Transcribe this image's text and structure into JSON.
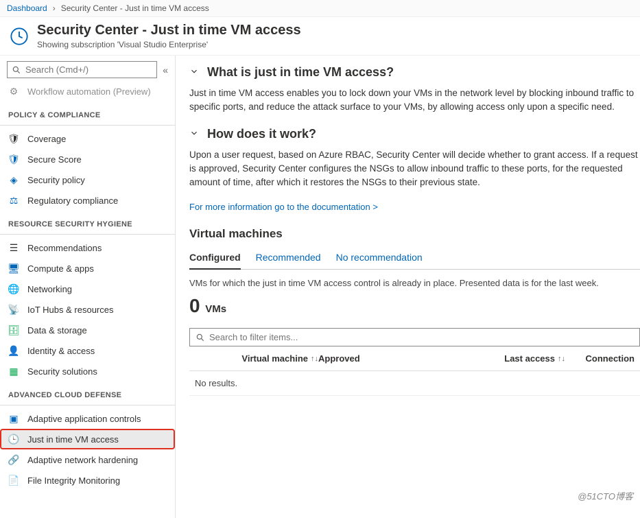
{
  "breadcrumb": {
    "root": "Dashboard",
    "current": "Security Center - Just in time VM access"
  },
  "header": {
    "title": "Security Center - Just in time VM access",
    "subtitle": "Showing subscription 'Visual Studio Enterprise'"
  },
  "search": {
    "placeholder": "Search (Cmd+/)"
  },
  "sidebar": {
    "top_item": "Workflow automation (Preview)",
    "sections": {
      "policy": {
        "header": "POLICY & COMPLIANCE",
        "items": [
          "Coverage",
          "Secure Score",
          "Security policy",
          "Regulatory compliance"
        ]
      },
      "hygiene": {
        "header": "RESOURCE SECURITY HYGIENE",
        "items": [
          "Recommendations",
          "Compute & apps",
          "Networking",
          "IoT Hubs & resources",
          "Data & storage",
          "Identity & access",
          "Security solutions"
        ]
      },
      "defense": {
        "header": "ADVANCED CLOUD DEFENSE",
        "items": [
          "Adaptive application controls",
          "Just in time VM access",
          "Adaptive network hardening",
          "File Integrity Monitoring"
        ]
      }
    }
  },
  "main": {
    "q1": {
      "title": "What is just in time VM access?",
      "body": "Just in time VM access enables you to lock down your VMs in the network level by blocking inbound traffic to specific ports, and reduce the attack surface to your VMs, by allowing access only upon a specific need."
    },
    "q2": {
      "title": "How does it work?",
      "body": "Upon a user request, based on Azure RBAC, Security Center will decide whether to grant access. If a request is approved, Security Center configures the NSGs to allow inbound traffic to these ports, for the requested amount of time, after which it restores the NSGs to their previous state."
    },
    "doc_link": "For more information go to the documentation >",
    "vm_header": "Virtual machines",
    "tabs": [
      "Configured",
      "Recommended",
      "No recommendation"
    ],
    "config_desc": "VMs for which the just in time VM access control is already in place. Presented data is for the last week.",
    "count": "0",
    "count_suffix": "VMs",
    "filter_placeholder": "Search to filter items...",
    "columns": [
      "Virtual machine",
      "Approved",
      "Last access",
      "Connection"
    ],
    "empty": "No results."
  },
  "watermark": "@51CTO博客"
}
